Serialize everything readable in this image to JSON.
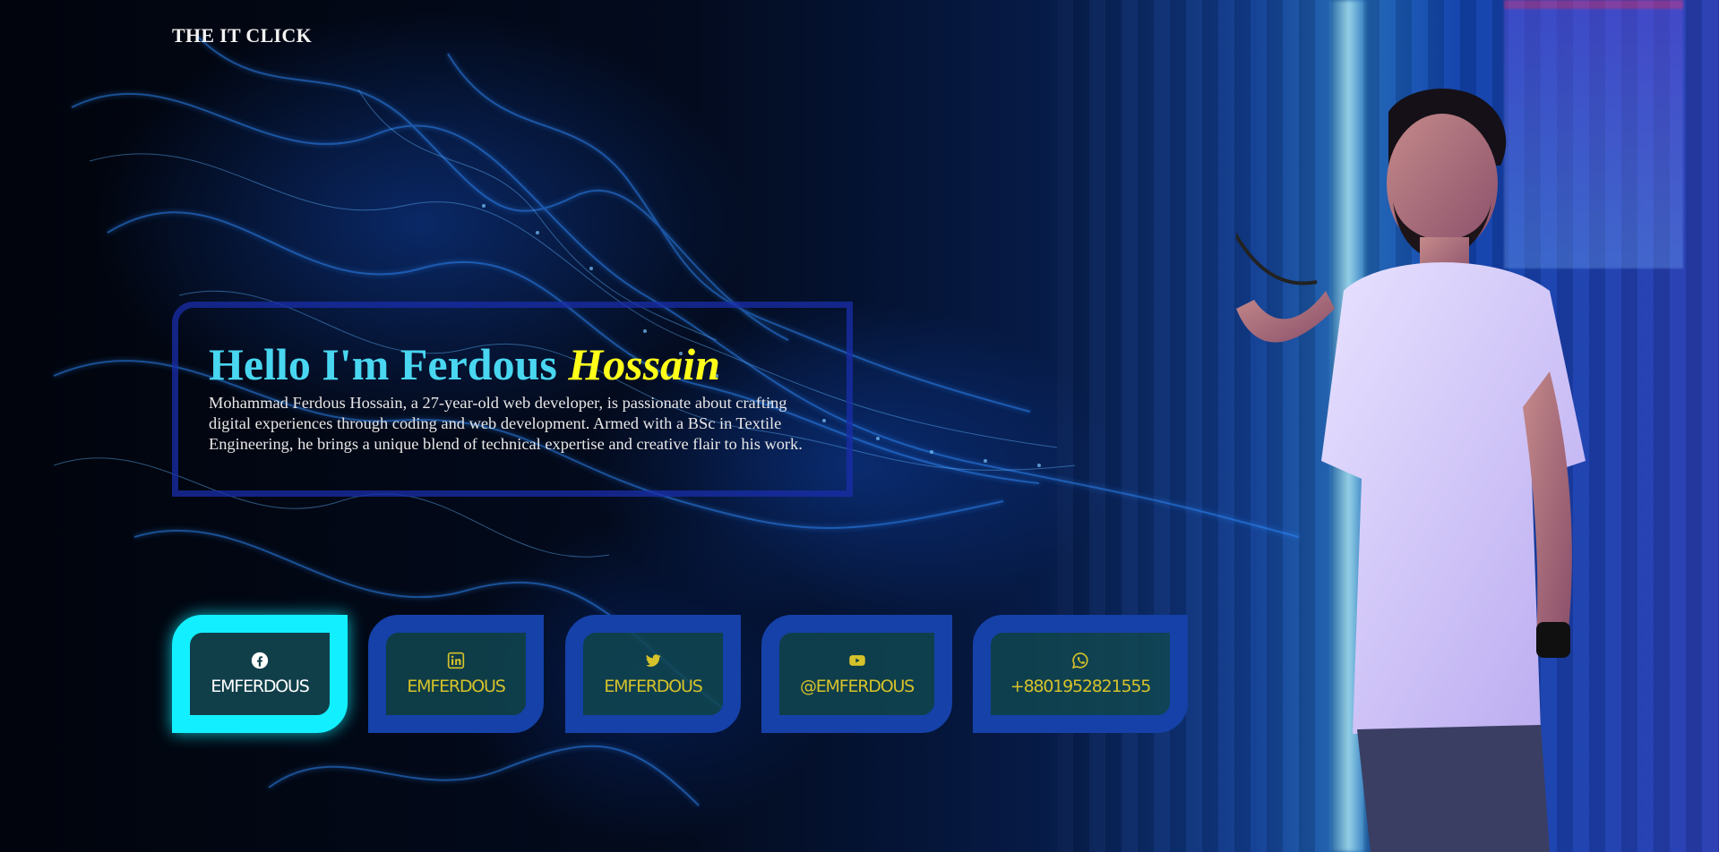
{
  "brand": {
    "name": "THE IT CLICK"
  },
  "intro": {
    "title_main": "Hello I'm Ferdous ",
    "title_highlight": "Hossain",
    "description": "Mohammad Ferdous Hossain, a 27-year-old web developer, is passionate about crafting digital experiences through coding and web development. Armed with a BSc in Textile Engineering, he brings a unique blend of technical expertise and creative flair to his work."
  },
  "socials": [
    {
      "icon": "facebook-icon",
      "label": "EMFERDOUS",
      "active": true
    },
    {
      "icon": "linkedin-icon",
      "label": "EMFERDOUS",
      "active": false
    },
    {
      "icon": "twitter-icon",
      "label": "EMFERDOUS",
      "active": false
    },
    {
      "icon": "youtube-icon",
      "label": "@EMFERDOUS",
      "active": false
    },
    {
      "icon": "whatsapp-icon",
      "label": "+8801952821555",
      "active": false
    }
  ],
  "colors": {
    "title_cyan": "#49d6f0",
    "highlight_yellow": "#ffff1a",
    "active_border": "#12f0ff",
    "button_border": "#1541a8",
    "button_label": "#d6c22a",
    "card_border": "#192daa"
  }
}
